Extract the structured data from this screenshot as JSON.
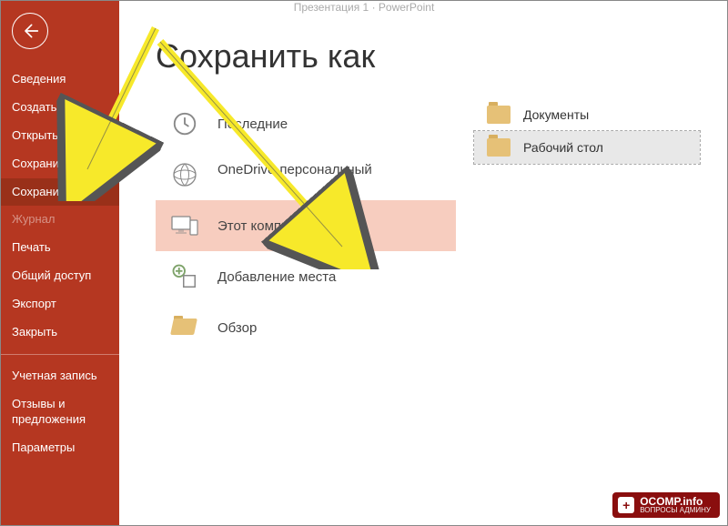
{
  "window": {
    "title_left": "Презентация 1",
    "title_right": "PowerPoint"
  },
  "sidebar": {
    "items": [
      {
        "label": "Сведения",
        "state": "normal"
      },
      {
        "label": "Создать",
        "state": "normal"
      },
      {
        "label": "Открыть",
        "state": "normal"
      },
      {
        "label": "Сохранить",
        "state": "normal"
      },
      {
        "label": "Сохранить как",
        "state": "active"
      },
      {
        "label": "Журнал",
        "state": "disabled"
      },
      {
        "label": "Печать",
        "state": "normal"
      },
      {
        "label": "Общий доступ",
        "state": "normal"
      },
      {
        "label": "Экспорт",
        "state": "normal"
      },
      {
        "label": "Закрыть",
        "state": "normal"
      }
    ],
    "footer": [
      {
        "label": "Учетная запись"
      },
      {
        "label": "Отзывы и предложения"
      },
      {
        "label": "Параметры"
      }
    ]
  },
  "page": {
    "title": "Сохранить как"
  },
  "locations": [
    {
      "label": "Последние",
      "icon": "clock"
    },
    {
      "label": "OneDrive-персональный",
      "icon": "onedrive",
      "sub": " "
    },
    {
      "label": "Этот компьютер",
      "icon": "pc",
      "selected": true
    },
    {
      "label": "Добавление места",
      "icon": "add-place"
    },
    {
      "label": "Обзор",
      "icon": "folder-open"
    }
  ],
  "right": [
    {
      "label": "Документы",
      "selected": false
    },
    {
      "label": "Рабочий стол",
      "selected": true
    }
  ],
  "watermark": {
    "brand": "OCOMP",
    "tld": ".info",
    "tagline": "ВОПРОСЫ АДМИНУ"
  }
}
